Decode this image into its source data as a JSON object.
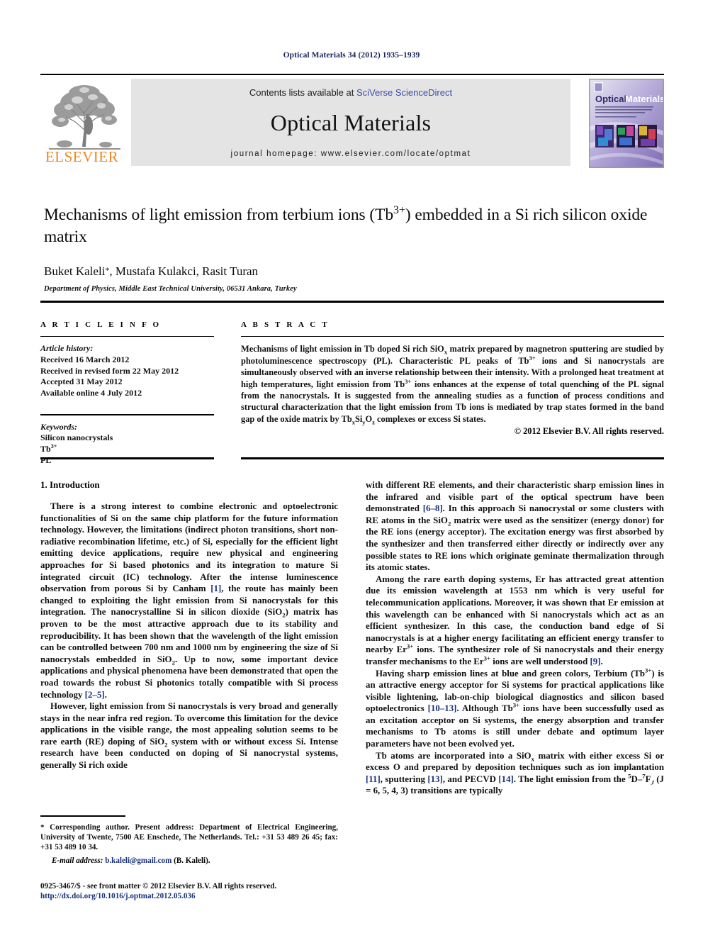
{
  "running_head": "Optical Materials 34 (2012) 1935–1939",
  "masthead": {
    "contents_prefix": "Contents lists available at ",
    "contents_link": "SciVerse ScienceDirect",
    "journal_title": "Optical Materials",
    "homepage": "journal homepage: www.elsevier.com/locate/optmat",
    "publisher": "ELSEVIER",
    "cover_title_1": "Optical",
    "cover_title_2": "Materials"
  },
  "article": {
    "title": "Mechanisms of light emission from terbium ions (Tb3+) embedded in a Si rich silicon oxide matrix",
    "title_part1": "Mechanisms of light emission from terbium ions (Tb",
    "title_sup": "3+",
    "title_part2": ") embedded in a Si rich silicon oxide matrix",
    "authors": "Buket Kaleli , Mustafa Kulakci, Rasit Turan",
    "authors_part1": "Buket Kaleli",
    "authors_star": "*",
    "authors_part2": ", Mustafa Kulakci, Rasit Turan",
    "affiliation": "Department of Physics, Middle East Technical University, 06531 Ankara, Turkey"
  },
  "info": {
    "heading": "A R T I C L E    I N F O",
    "history_label": "Article history:",
    "history": [
      "Received 16 March 2012",
      "Received in revised form 22 May 2012",
      "Accepted 31 May 2012",
      "Available online 4 July 2012"
    ],
    "keywords_label": "Keywords:",
    "keywords": [
      "Silicon nanocrystals",
      "Tb3+",
      "PL"
    ],
    "keyword_tb_base": "Tb",
    "keyword_tb_sup": "3+"
  },
  "abstract": {
    "heading": "A B S T R A C T",
    "p1_a": "Mechanisms of light emission in Tb doped Si rich SiO",
    "p1_sub1": "x",
    "p1_b": " matrix prepared by magnetron sputtering are studied by photoluminescence spectroscopy (PL). Characteristic PL peaks of Tb",
    "p1_sup1": "3+",
    "p1_c": " ions and Si nanocrystals are simultaneously observed with an inverse relationship between their intensity. With a prolonged heat treatment at high temperatures, light emission from Tb",
    "p1_sup2": "3+",
    "p1_d": " ions enhances at the expense of total quenching of the PL signal from the nanocrystals. It is suggested from the annealing studies as a function of process conditions and structural characterization that the light emission from Tb ions is mediated by trap states formed in the band gap of the oxide matrix by Tb",
    "p1_sub2": "x",
    "p1_e": "Si",
    "p1_sub3": "y",
    "p1_f": "O",
    "p1_sub4": "z",
    "p1_g": " complexes or excess Si states.",
    "copyright": "© 2012 Elsevier B.V. All rights reserved."
  },
  "body": {
    "section_title": "1. Introduction",
    "left": {
      "p1_a": "There is a strong interest to combine electronic and optoelectronic functionalities of Si on the same chip platform for the future information technology. However, the limitations (indirect photon transitions, short non-radiative recombination lifetime, etc.) of Si, especially for the efficient light emitting device applications, require new physical and engineering approaches for Si based photonics and its integration to mature Si integrated circuit (IC) technology. After the intense luminescence observation from porous Si by Canham ",
      "p1_ref1": "[1]",
      "p1_b": ", the route has mainly been changed to exploiting the light emission from Si nanocrystals for this integration. The nanocrystalline Si in silicon dioxide (SiO",
      "p1_sub1": "2",
      "p1_c": ") matrix has proven to be the most attractive approach due to its stability and reproducibility. It has been shown that the wavelength of the light emission can be controlled between 700 nm and 1000 nm by engineering the size of Si nanocrystals embedded in SiO",
      "p1_sub2": "2",
      "p1_d": ". Up to now, some important device applications and physical phenomena have been demonstrated that open the road towards the robust Si photonics totally compatible with Si process technology ",
      "p1_ref2": "[2–5]",
      "p1_e": ".",
      "p2_a": "However, light emission from Si nanocrystals is very broad and generally stays in the near infra red region. To overcome this limitation for the device applications in the visible range, the most appealing solution seems to be rare earth (RE) doping of SiO",
      "p2_sub1": "2",
      "p2_b": " system with or without excess Si. Intense research have been conducted on doping of Si nanocrystal systems, generally Si rich oxide"
    },
    "right": {
      "p1_a": "with different RE elements, and their characteristic sharp emission lines in the infrared and visible part of the optical spectrum have been demonstrated ",
      "p1_ref1": "[6–8]",
      "p1_b": ". In this approach Si nanocrystal or some clusters with RE atoms in the SiO",
      "p1_sub1": "2",
      "p1_c": " matrix were used as the sensitizer (energy donor) for the RE ions (energy acceptor). The excitation energy was first absorbed by the synthesizer and then transferred either directly or indirectly over any possible states to RE ions which originate geminate thermalization through its atomic states.",
      "p2_a": "Among the rare earth doping systems, Er has attracted great attention due its emission wavelength at 1553 nm which is very useful for telecommunication applications. Moreover, it was shown that Er emission at this wavelength can be enhanced with Si nanocrystals which act as an efficient synthesizer. In this case, the conduction band edge of Si nanocrystals is at a higher energy facilitating an efficient energy transfer to nearby Er",
      "p2_sup1": "3+",
      "p2_b": " ions. The synthesizer role of Si nanocrystals and their energy transfer mechanisms to the Er",
      "p2_sup2": "3+",
      "p2_c": " ions are well understood ",
      "p2_ref1": "[9]",
      "p2_d": ".",
      "p3_a": "Having sharp emission lines at blue and green colors, Terbium (Tb",
      "p3_sup1": "3+",
      "p3_b": ") is an attractive energy acceptor for Si systems for practical applications like visible lightening, lab-on-chip biological diagnostics and silicon based optoelectronics ",
      "p3_ref1": "[10–13]",
      "p3_c": ". Although Tb",
      "p3_sup2": "3+",
      "p3_d": " ions have been successfully used as an excitation acceptor on Si systems, the energy absorption and transfer mechanisms to Tb atoms is still under debate and optimum layer parameters have not been evolved yet.",
      "p4_a": "Tb atoms are incorporated into a SiO",
      "p4_sub1": "x",
      "p4_b": " matrix with either excess Si or excess O and prepared by deposition techniques such as ion implantation ",
      "p4_ref1": "[11]",
      "p4_c": ", sputtering ",
      "p4_ref2": "[13]",
      "p4_d": ", and PECVD ",
      "p4_ref3": "[14]",
      "p4_e": ". The light emission from the ",
      "p4_sup1": "5",
      "p4_f": "D–",
      "p4_sup2": "7",
      "p4_g": "F",
      "p4_subJ": "J",
      "p4_h": "  (J = 6, 5, 4, 3) transitions are typically"
    }
  },
  "footnote": {
    "star": "*",
    "text": " Corresponding author. Present address: Department of Electrical Engineering, University of Twente, 7500 AE Enschede, The Netherlands. Tel.: +31 53 489 26 45; fax: +31 53 489 10 34.",
    "email_label": "E-mail address:",
    "email": "b.kaleli@gmail.com",
    "email_owner": "(B. Kaleli)."
  },
  "imprint": {
    "line1": "0925-3467/$ - see front matter © 2012 Elsevier B.V. All rights reserved.",
    "doi": "http://dx.doi.org/10.1016/j.optmat.2012.05.036"
  },
  "colors": {
    "running_head": "#17255c",
    "link": "#3b4fa8",
    "reference": "#17307e",
    "elsevier_orange": "#ec8824",
    "band_gray": "#e4e4e4"
  }
}
